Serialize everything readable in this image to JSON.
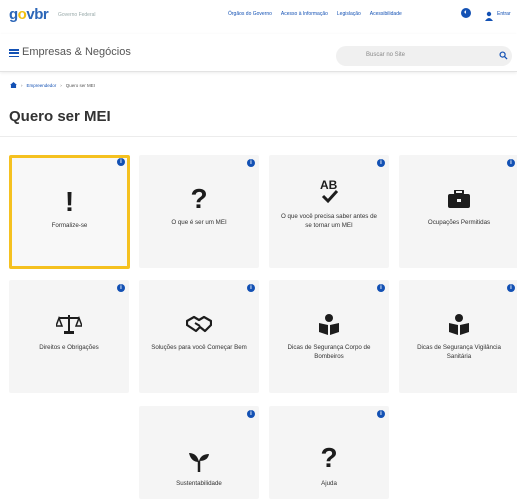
{
  "header": {
    "logo": {
      "g": "g",
      "o": "o",
      "v": "v",
      "b": "br"
    },
    "logo_subtitle": "Governo Federal",
    "links": [
      "Órgãos do Governo",
      "Acesso à Informação",
      "Legislação",
      "Acessibilidade"
    ],
    "entrar_label": "Entrar"
  },
  "nav": {
    "title": "Empresas & Negócios",
    "search_placeholder": "Buscar no Site"
  },
  "breadcrumb": {
    "items": [
      "Empreendedor",
      "Quero ser MEI"
    ]
  },
  "page": {
    "title": "Quero ser MEI"
  },
  "cards": [
    {
      "label": "Formalize-se",
      "icon": "exclamation-icon",
      "glyph": "!"
    },
    {
      "label": "O que é ser um MEI",
      "icon": "question-icon",
      "glyph": "?"
    },
    {
      "label": "O que você precisa saber antes de se tornar um MEI",
      "icon": "spellcheck-icon",
      "glyph": "AB"
    },
    {
      "label": "Ocupações Permitidas",
      "icon": "briefcase-icon"
    },
    {
      "label": "Direitos e Obrigações",
      "icon": "scale-icon"
    },
    {
      "label": "Soluções para você Começar Bem",
      "icon": "handshake-icon"
    },
    {
      "label": "Dicas de Segurança Corpo de Bombeiros",
      "icon": "reader-icon"
    },
    {
      "label": "Dicas de Segurança Vigilância Sanitária",
      "icon": "reader-icon"
    },
    {
      "label": "Sustentabilidade",
      "icon": "seedling-icon"
    },
    {
      "label": "Ajuda",
      "icon": "question-icon",
      "glyph": "?"
    }
  ],
  "info_badge": "i",
  "colors": {
    "accent": "#1351b4",
    "focus": "#f5c120",
    "card_bg": "#f5f5f5"
  }
}
